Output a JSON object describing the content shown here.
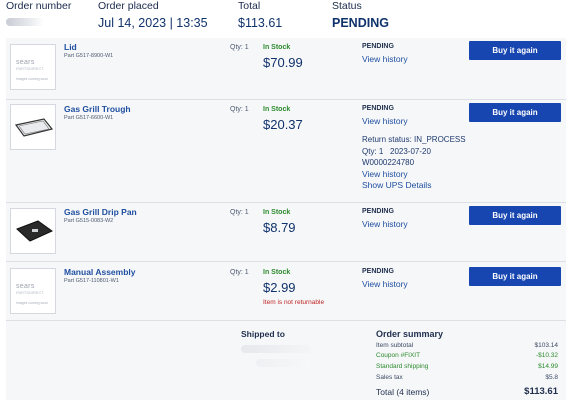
{
  "header": {
    "order_number_label": "Order number",
    "order_placed_label": "Order placed",
    "order_placed_value": "Jul 14, 2023 | 13:35",
    "total_label": "Total",
    "total_value": "$113.61",
    "status_label": "Status",
    "status_value": "PENDING"
  },
  "items": [
    {
      "name": "Lid",
      "part": "Part G517-8900-W1",
      "qty": "Qty: 1",
      "stock": "In Stock",
      "price": "$70.99",
      "status": "PENDING",
      "view_history": "View history",
      "buy_label": "Buy it again",
      "thumb_logo": "sears",
      "thumb_sub": "PARTSDIRECT",
      "thumb_site": "images coming soon"
    },
    {
      "name": "Gas Grill Trough",
      "part": "Part G517-6600-W1",
      "qty": "Qty: 1",
      "stock": "In Stock",
      "price": "$20.37",
      "status": "PENDING",
      "view_history": "View history",
      "buy_label": "Buy it again",
      "return_status": "Return status: IN_PROCESS",
      "return_qty_date": "Qty: 1   2023-07-20",
      "return_id": "W0000224780",
      "return_view_history": "View history",
      "show_ups": "Show UPS Details"
    },
    {
      "name": "Gas Grill Drip Pan",
      "part": "Part G515-0083-W2",
      "qty": "Qty: 1",
      "stock": "In Stock",
      "price": "$8.79",
      "status": "PENDING",
      "view_history": "View history",
      "buy_label": "Buy it again"
    },
    {
      "name": "Manual Assembly",
      "part": "Part G517-110801-W1",
      "qty": "Qty: 1",
      "stock": "In Stock",
      "price": "$2.99",
      "note": "Item is not returnable",
      "status": "PENDING",
      "view_history": "View history",
      "buy_label": "Buy it again",
      "thumb_logo": "sears",
      "thumb_sub": "PARTSDIRECT",
      "thumb_site": "images coming soon"
    }
  ],
  "shipping": {
    "label": "Shipped to"
  },
  "summary": {
    "title": "Order summary",
    "rows": [
      {
        "label": "Item subtotal",
        "value": "$103.14"
      },
      {
        "label": "Coupon #FIXIT",
        "value": "-$10.32"
      },
      {
        "label": "Standard shipping",
        "value": "$14.99"
      },
      {
        "label": "Sales tax",
        "value": "$5.8"
      }
    ],
    "total_label": "Total (4 items)",
    "total_value": "$113.61"
  },
  "colors": {
    "primary_button": "#1746b0",
    "link": "#1f4fa0",
    "in_stock": "#2c8a2c",
    "warning": "#c02525"
  }
}
